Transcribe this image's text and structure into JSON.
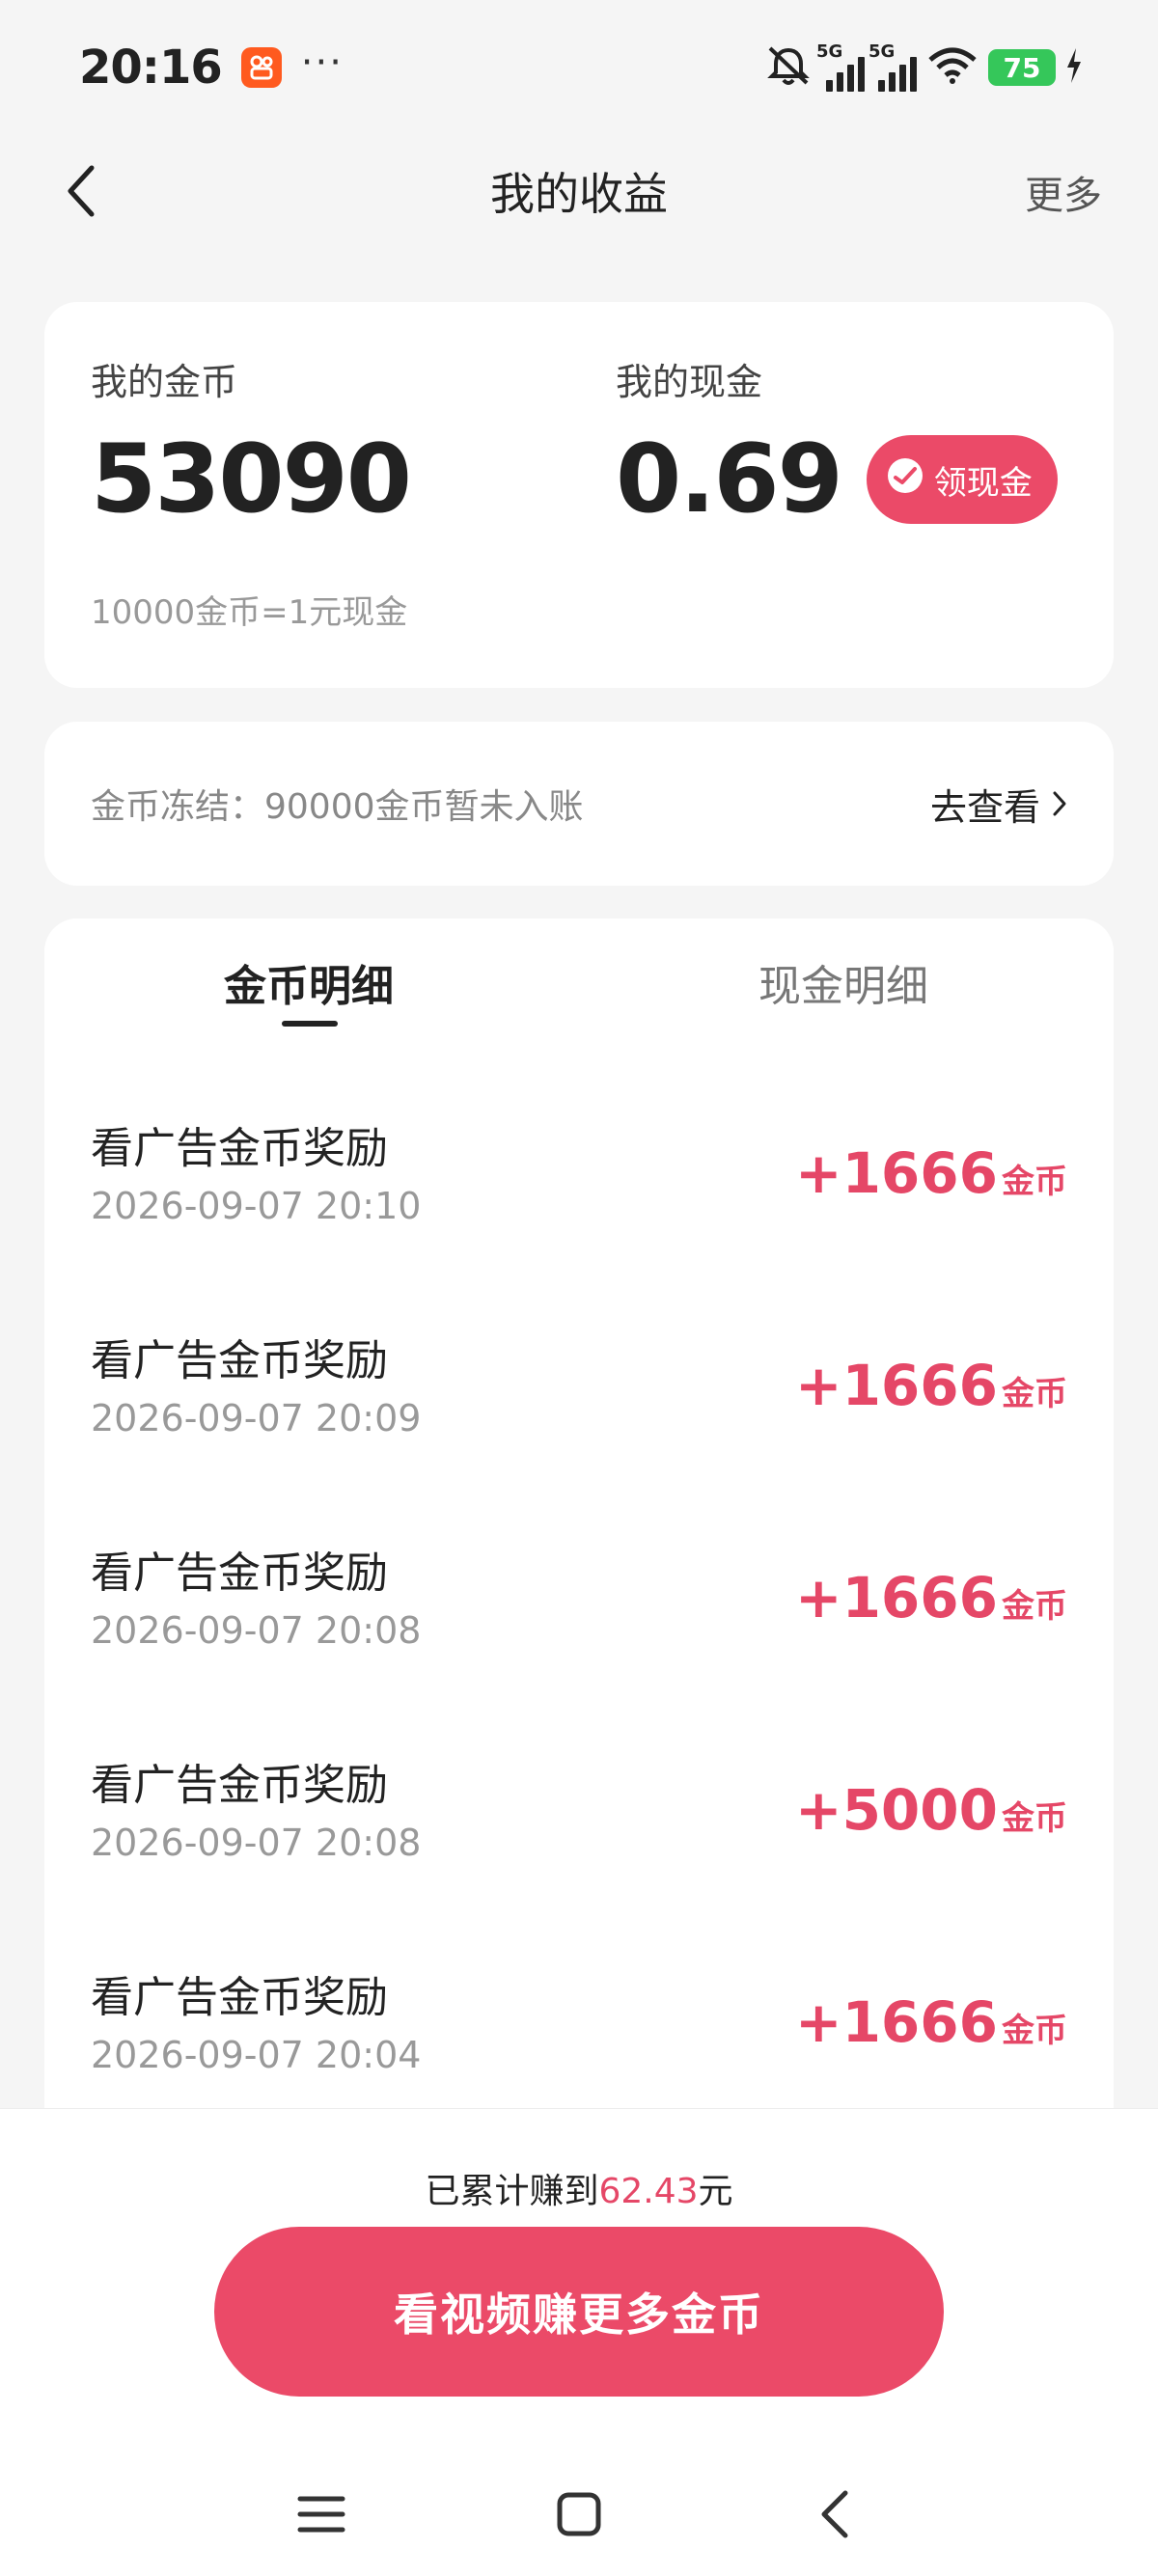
{
  "status_bar": {
    "time": "20:16",
    "dots": "···",
    "network_label_1": "5G",
    "network_label_2": "5G",
    "battery": "75",
    "icons": [
      "app-icon",
      "mute-icon",
      "signal-icon",
      "wifi-icon",
      "battery-icon",
      "charging-icon"
    ]
  },
  "header": {
    "title": "我的收益",
    "more_label": "更多"
  },
  "summary": {
    "coin_label": "我的金币",
    "coin_value": "53090",
    "cash_label": "我的现金",
    "cash_value": "0.69",
    "claim_button": "领现金",
    "rate_text": "10000金币=1元现金"
  },
  "frozen": {
    "text": "金币冻结：90000金币暂未入账",
    "link": "去查看"
  },
  "tabs": {
    "coin_detail": "金币明细",
    "cash_detail": "现金明细",
    "active": "coin_detail"
  },
  "records": [
    {
      "title": "看广告金币奖励",
      "time": "2026-09-07 20:10",
      "amount": "+1666",
      "unit": "金币"
    },
    {
      "title": "看广告金币奖励",
      "time": "2026-09-07 20:09",
      "amount": "+1666",
      "unit": "金币"
    },
    {
      "title": "看广告金币奖励",
      "time": "2026-09-07 20:08",
      "amount": "+1666",
      "unit": "金币"
    },
    {
      "title": "看广告金币奖励",
      "time": "2026-09-07 20:08",
      "amount": "+5000",
      "unit": "金币"
    },
    {
      "title": "看广告金币奖励",
      "time": "2026-09-07 20:04",
      "amount": "+1666",
      "unit": "金币"
    }
  ],
  "bottom": {
    "total_prefix": "已累计赚到",
    "total_amount": "62.43",
    "total_suffix": "元",
    "watch_button": "看视频赚更多金币"
  },
  "colors": {
    "accent": "#eb4a68",
    "amount": "#e54767",
    "battery": "#35c75a"
  }
}
